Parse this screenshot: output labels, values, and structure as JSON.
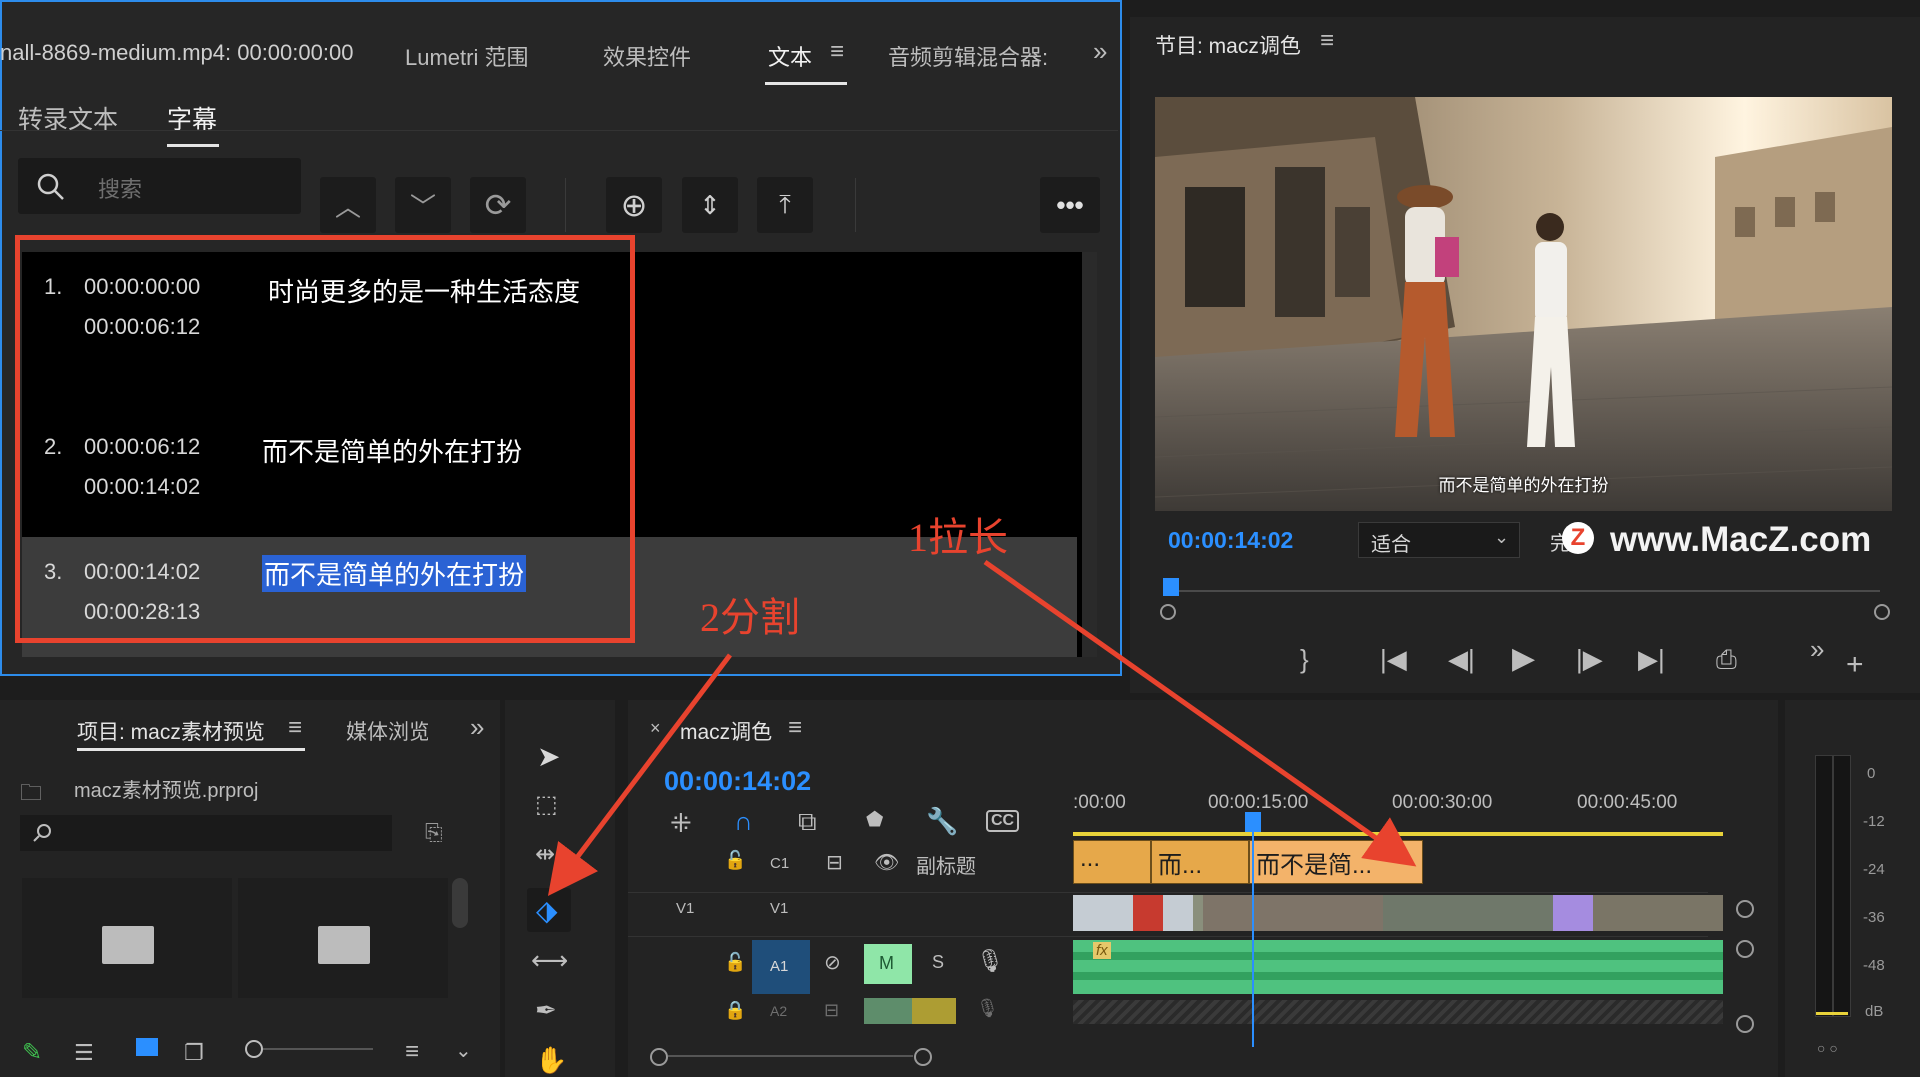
{
  "text_panel": {
    "tabs": [
      "nall-8869-medium.mp4: 00:00:00:00",
      "Lumetri 范围",
      "效果控件",
      "文本",
      "音频剪辑混合器:"
    ],
    "subtabs": [
      "转录文本",
      "字幕"
    ],
    "search_placeholder": "搜索",
    "captions": [
      {
        "num": "1.",
        "in": "00:00:00:00",
        "out": "00:00:06:12",
        "text": "时尚更多的是一种生活态度"
      },
      {
        "num": "2.",
        "in": "00:00:06:12",
        "out": "00:00:14:02",
        "text": "而不是简单的外在打扮"
      },
      {
        "num": "3.",
        "in": "00:00:14:02",
        "out": "00:00:28:13",
        "text": "而不是简单的外在打扮"
      }
    ]
  },
  "annotations": {
    "stretch": "1拉长",
    "split": "2分割"
  },
  "program": {
    "title": "节目: macz调色",
    "timecode": "00:00:14:02",
    "fit": "适合",
    "fit_partial": "完",
    "subtitle_overlay": "而不是简单的外在打扮",
    "watermark": "www.MacZ.com"
  },
  "project": {
    "title": "项目: macz素材预览",
    "tab2": "媒体浏览",
    "file": "macz素材预览.prproj"
  },
  "timeline": {
    "sequence": "macz调色",
    "timecode": "00:00:14:02",
    "ruler": [
      ":00:00",
      "00:00:15:00",
      "00:00:30:00",
      "00:00:45:00"
    ],
    "c1_track": "C1",
    "c1_name": "副标题",
    "clips": [
      "...",
      "而...",
      "而不是简..."
    ],
    "v1_left": "V1",
    "v1_right": "V1",
    "a1": "A1",
    "a2": "A2",
    "m": "M",
    "s": "S",
    "fx": "fx"
  },
  "meter": {
    "labels": [
      "0",
      "-12",
      "-24",
      "-36",
      "-48",
      "dB"
    ]
  }
}
